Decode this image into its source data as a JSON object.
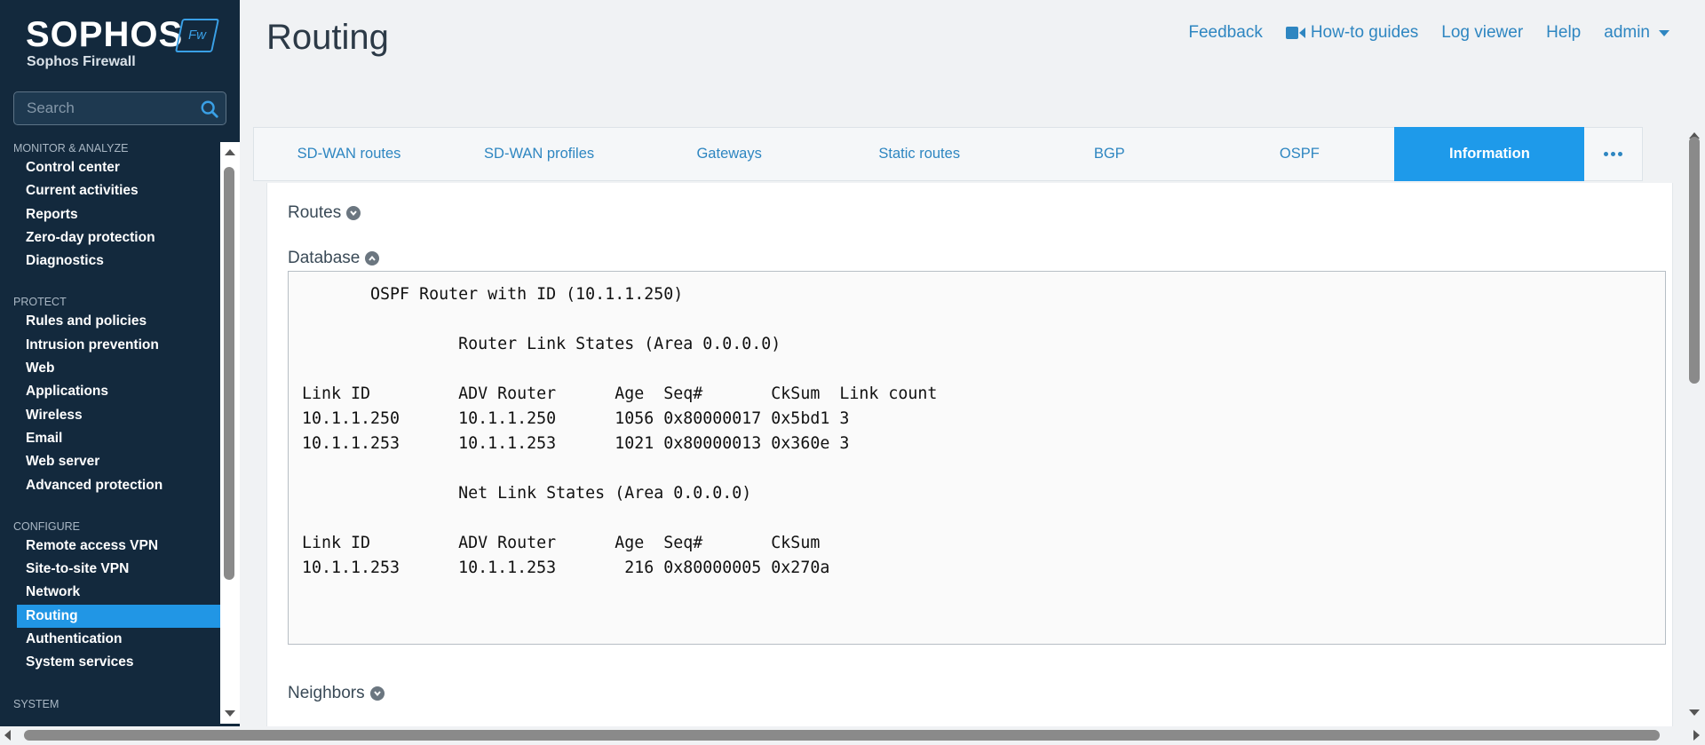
{
  "brand": {
    "name": "SOPHOS",
    "badge": "Fw",
    "product": "Sophos Firewall"
  },
  "search": {
    "placeholder": "Search"
  },
  "sidebar": {
    "sections": [
      {
        "title": "MONITOR & ANALYZE",
        "items": [
          "Control center",
          "Current activities",
          "Reports",
          "Zero-day protection",
          "Diagnostics"
        ]
      },
      {
        "title": "PROTECT",
        "items": [
          "Rules and policies",
          "Intrusion prevention",
          "Web",
          "Applications",
          "Wireless",
          "Email",
          "Web server",
          "Advanced protection"
        ]
      },
      {
        "title": "CONFIGURE",
        "items": [
          "Remote access VPN",
          "Site-to-site VPN",
          "Network",
          "Routing",
          "Authentication",
          "System services"
        ]
      },
      {
        "title": "SYSTEM",
        "items": []
      }
    ],
    "active_item": "Routing"
  },
  "header": {
    "title": "Routing",
    "links": {
      "feedback": "Feedback",
      "guides": "How-to guides",
      "logviewer": "Log viewer",
      "help": "Help",
      "user": "admin"
    }
  },
  "tabs": {
    "items": [
      "SD-WAN routes",
      "SD-WAN profiles",
      "Gateways",
      "Static routes",
      "BGP",
      "OSPF",
      "Information"
    ],
    "active": "Information"
  },
  "content": {
    "routes_label": "Routes",
    "database_label": "Database",
    "neighbors_label": "Neighbors",
    "database_text": "       OSPF Router with ID (10.1.1.250)\n\n                Router Link States (Area 0.0.0.0)\n\nLink ID         ADV Router      Age  Seq#       CkSum  Link count\n10.1.1.250      10.1.1.250      1056 0x80000017 0x5bd1 3\n10.1.1.253      10.1.1.253      1021 0x80000013 0x360e 3\n\n                Net Link States (Area 0.0.0.0)\n\nLink ID         ADV Router      Age  Seq#       CkSum\n10.1.1.253      10.1.1.253       216 0x80000005 0x270a"
  },
  "colors": {
    "sidebar_bg": "#13293d",
    "accent": "#1e9aea",
    "link": "#2e86c1"
  }
}
